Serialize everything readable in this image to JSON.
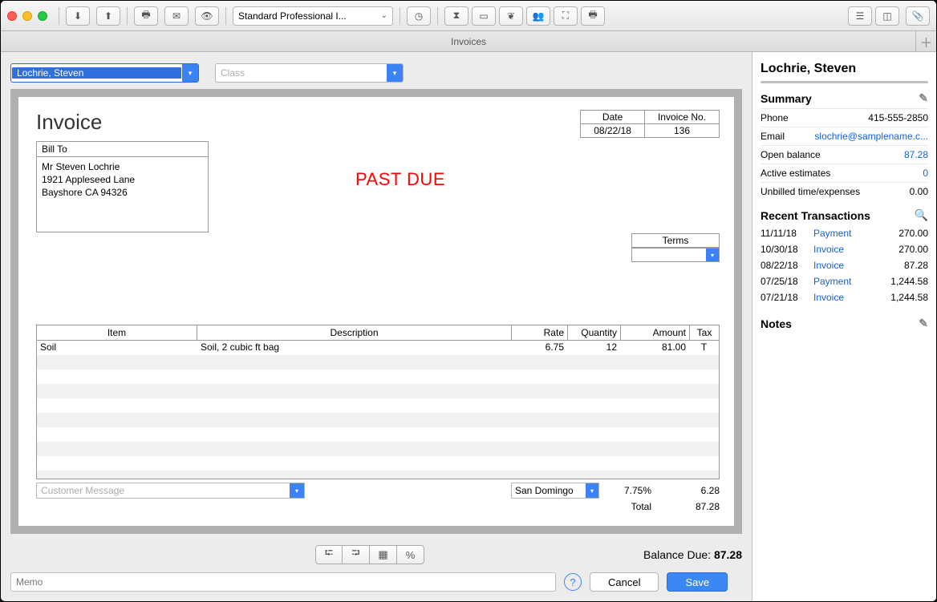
{
  "window": {
    "tab_title": "Invoices"
  },
  "toolbar": {
    "template_select": "Standard Professional I..."
  },
  "controls": {
    "customer": "Lochrie, Steven",
    "class_placeholder": "Class"
  },
  "invoice": {
    "title": "Invoice",
    "date_label": "Date",
    "date": "08/22/18",
    "invno_label": "Invoice No.",
    "invno": "136",
    "billto_label": "Bill To",
    "billto_line1": "Mr Steven Lochrie",
    "billto_line2": "1921 Appleseed Lane",
    "billto_line3": "Bayshore CA 94326",
    "stamp": "PAST DUE",
    "terms_label": "Terms",
    "headers": {
      "item": "Item",
      "description": "Description",
      "rate": "Rate",
      "quantity": "Quantity",
      "amount": "Amount",
      "tax": "Tax"
    },
    "lines": [
      {
        "item": "Soil",
        "desc": "Soil, 2 cubic ft bag",
        "rate": "6.75",
        "qty": "12",
        "amount": "81.00",
        "tax": "T"
      }
    ],
    "cust_msg_placeholder": "Customer Message",
    "tax_name": "San Domingo",
    "tax_rate": "7.75%",
    "tax_amount": "6.28",
    "total_label": "Total",
    "total": "87.28"
  },
  "footer": {
    "balance_label": "Balance Due:",
    "balance": "87.28",
    "memo_placeholder": "Memo",
    "cancel": "Cancel",
    "save": "Save"
  },
  "sidebar": {
    "name": "Lochrie, Steven",
    "summary_h": "Summary",
    "phone_l": "Phone",
    "phone": "415-555-2850",
    "email_l": "Email",
    "email": "slochrie@samplename.c...",
    "openbal_l": "Open balance",
    "openbal": "87.28",
    "est_l": "Active estimates",
    "est": "0",
    "unbilled_l": "Unbilled time/expenses",
    "unbilled": "0.00",
    "recent_h": "Recent Transactions",
    "recent": [
      {
        "date": "11/11/18",
        "type": "Payment",
        "amt": "270.00"
      },
      {
        "date": "10/30/18",
        "type": "Invoice",
        "amt": "270.00"
      },
      {
        "date": "08/22/18",
        "type": "Invoice",
        "amt": "87.28"
      },
      {
        "date": "07/25/18",
        "type": "Payment",
        "amt": "1,244.58"
      },
      {
        "date": "07/21/18",
        "type": "Invoice",
        "amt": "1,244.58"
      }
    ],
    "notes_h": "Notes"
  }
}
